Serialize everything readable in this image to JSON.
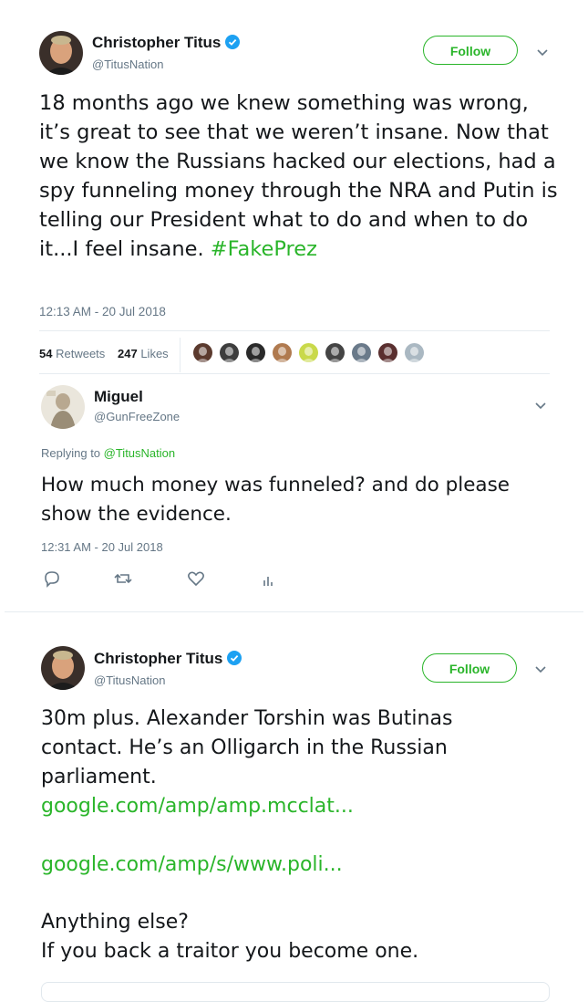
{
  "tweet1": {
    "author_name": "Christopher Titus",
    "author_handle": "@TitusNation",
    "follow_label": "Follow",
    "text_main": "18 months ago we knew something was wrong, it’s great to see that we weren’t insane. Now that we know the Russians hacked our elections, had a spy funneling money through the NRA and Putin is telling our President what to do and when to do it...I feel insane. ",
    "hashtag": "#FakePrez",
    "timestamp": "12:13 AM - 20 Jul 2018",
    "retweets_count": "54",
    "retweets_label": "Retweets",
    "likes_count": "247",
    "likes_label": "Likes",
    "liker_avatars": [
      "avatar-1",
      "avatar-2",
      "avatar-3",
      "avatar-4",
      "avatar-5",
      "avatar-6",
      "avatar-7",
      "avatar-8",
      "avatar-9"
    ]
  },
  "reply1": {
    "author_name": "Miguel",
    "author_handle": "@GunFreeZone",
    "replying_prefix": "Replying to ",
    "replying_handle": "@TitusNation",
    "text": "How much money was funneled? and do please show the evidence.",
    "timestamp": "12:31 AM - 20 Jul 2018",
    "actions": [
      "reply-icon",
      "retweet-icon",
      "like-icon",
      "analytics-icon"
    ]
  },
  "tweet2": {
    "author_name": "Christopher Titus",
    "author_handle": "@TitusNation",
    "follow_label": "Follow",
    "text_1": "30m plus. Alexander Torshin was Butinas contact. He’s an Olligarch in the Russian parliament.",
    "link_1": "google.com/amp/amp.mcclat...",
    "link_2": "google.com/amp/s/www.poli...",
    "text_2": "Anything else?",
    "text_3": "If you back a traitor you become one."
  },
  "colors": {
    "accent": "#2ab52a",
    "text": "#14171a",
    "muted": "#657786",
    "verified": "#1da1f2",
    "divider": "#e6ecf0"
  }
}
